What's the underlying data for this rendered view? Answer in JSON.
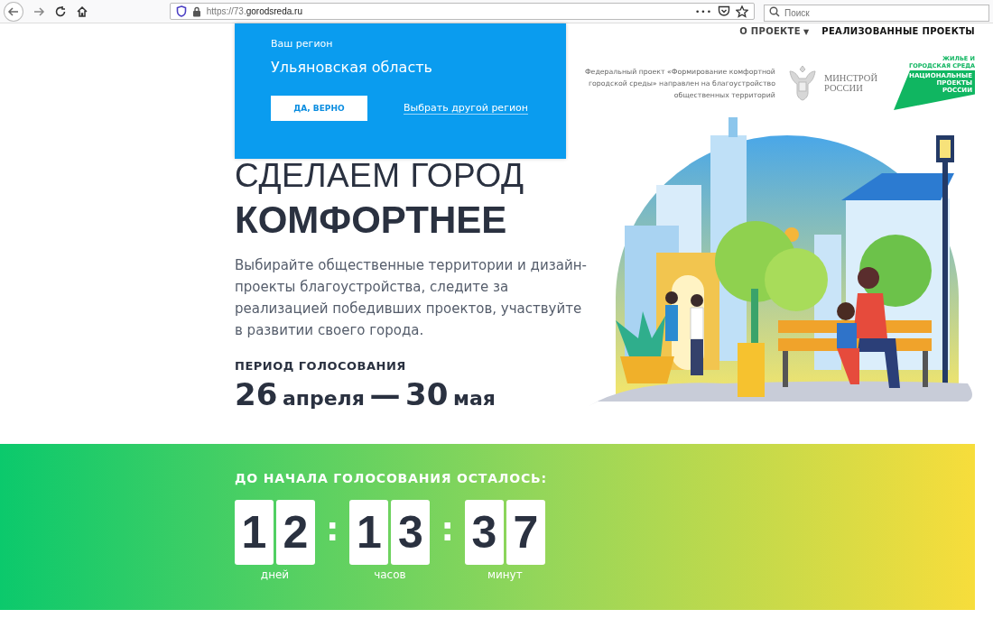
{
  "browser": {
    "url_prefix": "https://73.",
    "url_domain": "gorodsreda.ru",
    "more": "•••",
    "search": {
      "placeholder": "Поиск"
    }
  },
  "nav": [
    {
      "label": "О ПРОЕКТЕ",
      "dropdown": true,
      "caret": "▼"
    },
    {
      "label": "РЕАЛИЗОВАННЫЕ ПРОЕКТЫ",
      "dropdown": false
    }
  ],
  "region_popup": {
    "label": "Ваш регион",
    "region": "Ульяновская область",
    "confirm": "ДА, ВЕРНО",
    "other": "Выбрать другой регион"
  },
  "partners": {
    "text": "Федеральный проект «Формирование комфортной городской среды» направлен на благоустройство общественных территорий",
    "ministry": [
      "МИНСТРОЙ",
      "РОССИИ"
    ],
    "national_tag": [
      "ЖИЛЬЕ И",
      "ГОРОДСКАЯ СРЕДА"
    ],
    "national": [
      "НАЦИОНАЛЬНЫЕ",
      "ПРОЕКТЫ",
      "РОССИИ"
    ]
  },
  "hero": {
    "title_light": "СДЕЛАЕМ ГОРОД",
    "title_bold": "КОМФОРТНЕЕ",
    "description": "Выбирайте общественные территории и дизайн-проекты благоустройства, следите за реализацией победивших проектов, участвуйте в развитии своего города.",
    "period_label": "ПЕРИОД ГОЛОСОВАНИЯ",
    "period": [
      {
        "kind": "number",
        "text": "26"
      },
      {
        "kind": "word",
        "text": "апреля"
      },
      {
        "kind": "number",
        "text": "—"
      },
      {
        "kind": "number",
        "text": "30"
      },
      {
        "kind": "word",
        "text": "мая"
      }
    ]
  },
  "countdown": {
    "title": "ДО НАЧАЛА ГОЛОСОВАНИЯ ОСТАЛОСЬ:",
    "separators": [
      ":",
      ":"
    ],
    "units": [
      {
        "digits": [
          "1",
          "2"
        ],
        "label": "дней"
      },
      {
        "digits": [
          "1",
          "3"
        ],
        "label": "часов"
      },
      {
        "digits": [
          "3",
          "7"
        ],
        "label": "минут"
      }
    ]
  }
}
